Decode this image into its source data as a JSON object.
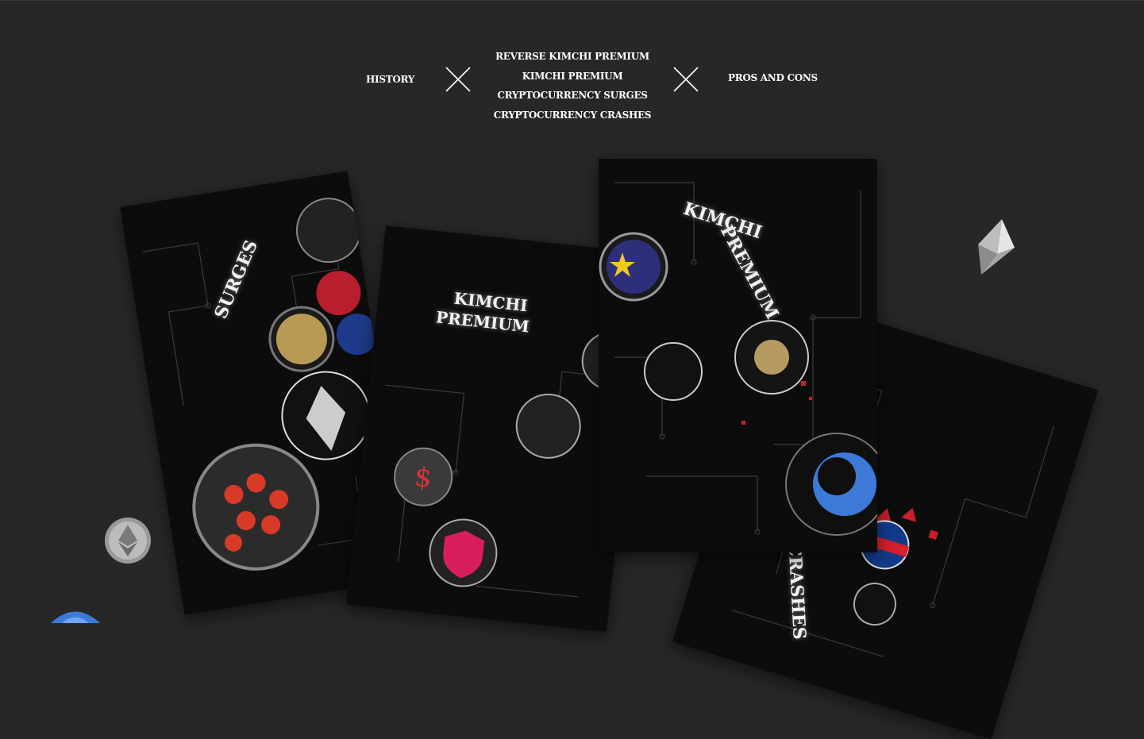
{
  "nav": {
    "left": "HISTORY",
    "center": [
      "REVERSE KIMCHI PREMIUM",
      "KIMCHI PREMIUM",
      "CRYPTOCURRENCY SURGES",
      "CRYPTOCURRENCY CRASHES"
    ],
    "right": "PROS AND CONS"
  },
  "posters": {
    "surges": "SURGES",
    "kimchi_a_line1": "KIMCHI",
    "kimchi_a_line2": "PREMIUM",
    "kimchi_b_line1": "KIMCHI",
    "kimchi_b_line2": "PREMIUM",
    "crashes": "CRASHES"
  },
  "icons": {
    "close_left": "x-icon",
    "close_right": "x-icon",
    "ethereum": "ethereum-diamond-icon",
    "eth_badge": "ethereum-badge-icon",
    "bitcoin_partial": "blue-coin-icon"
  },
  "colors": {
    "background": "#272727",
    "poster": "#0c0c0c",
    "accent_red": "#c8202a"
  }
}
